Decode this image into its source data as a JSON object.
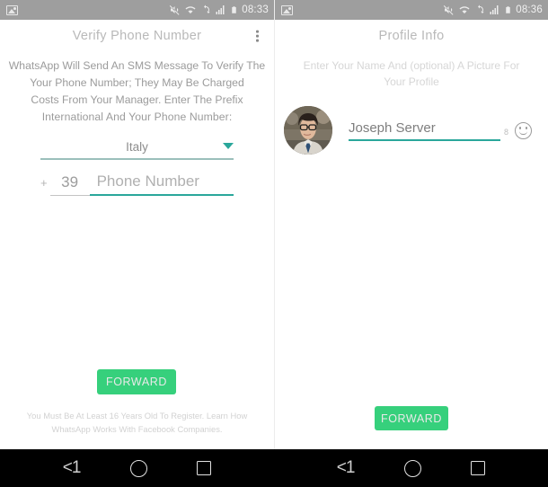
{
  "statusbar": {
    "left": {
      "photo_icon": "image-icon",
      "time": "08:33",
      "icons": [
        "mute-icon",
        "wifi-icon",
        "sync-error-icon",
        "signal-icon",
        "battery-icon"
      ]
    },
    "right": {
      "photo_icon": "image-icon",
      "time": "08:36",
      "icons": [
        "mute-icon",
        "wifi-icon",
        "sync-error-icon",
        "signal-icon",
        "battery-icon"
      ]
    }
  },
  "left_panel": {
    "title": "Verify Phone Number",
    "menu_icon": "kebab-menu-icon",
    "description": [
      "WhatsApp Will Send An SMS Message To Verify The",
      "Your Phone Number; They May Be Charged",
      "Costs From Your Manager. Enter The Prefix",
      "International And Your Phone Number:"
    ],
    "country": {
      "value": "Italy",
      "caret_icon": "chevron-down-icon"
    },
    "phone": {
      "plus": "+",
      "prefix": "39",
      "placeholder": "Phone Number"
    },
    "forward_label": "FORWARD",
    "footer": [
      "You Must Be At Least 16 Years Old To Register. Learn How",
      "WhatsApp Works With Facebook Companies."
    ]
  },
  "right_panel": {
    "title": "Profile Info",
    "description": [
      "Enter Your Name And (optional) A Picture For",
      "Your Profile"
    ],
    "avatar": "user-avatar-photo",
    "name": {
      "value": "Joseph Server",
      "char_counter": "8",
      "emoji_icon": "smiley-icon"
    },
    "forward_label": "FORWARD"
  },
  "navbar": {
    "back_label": "<1",
    "home_icon": "home-circle-icon",
    "recents_icon": "recents-square-icon"
  },
  "colors": {
    "accent_green": "#36d07c",
    "accent_teal": "#2aa79b",
    "statusbar_gray": "#9e9e9e",
    "navbar_black": "#000000"
  }
}
